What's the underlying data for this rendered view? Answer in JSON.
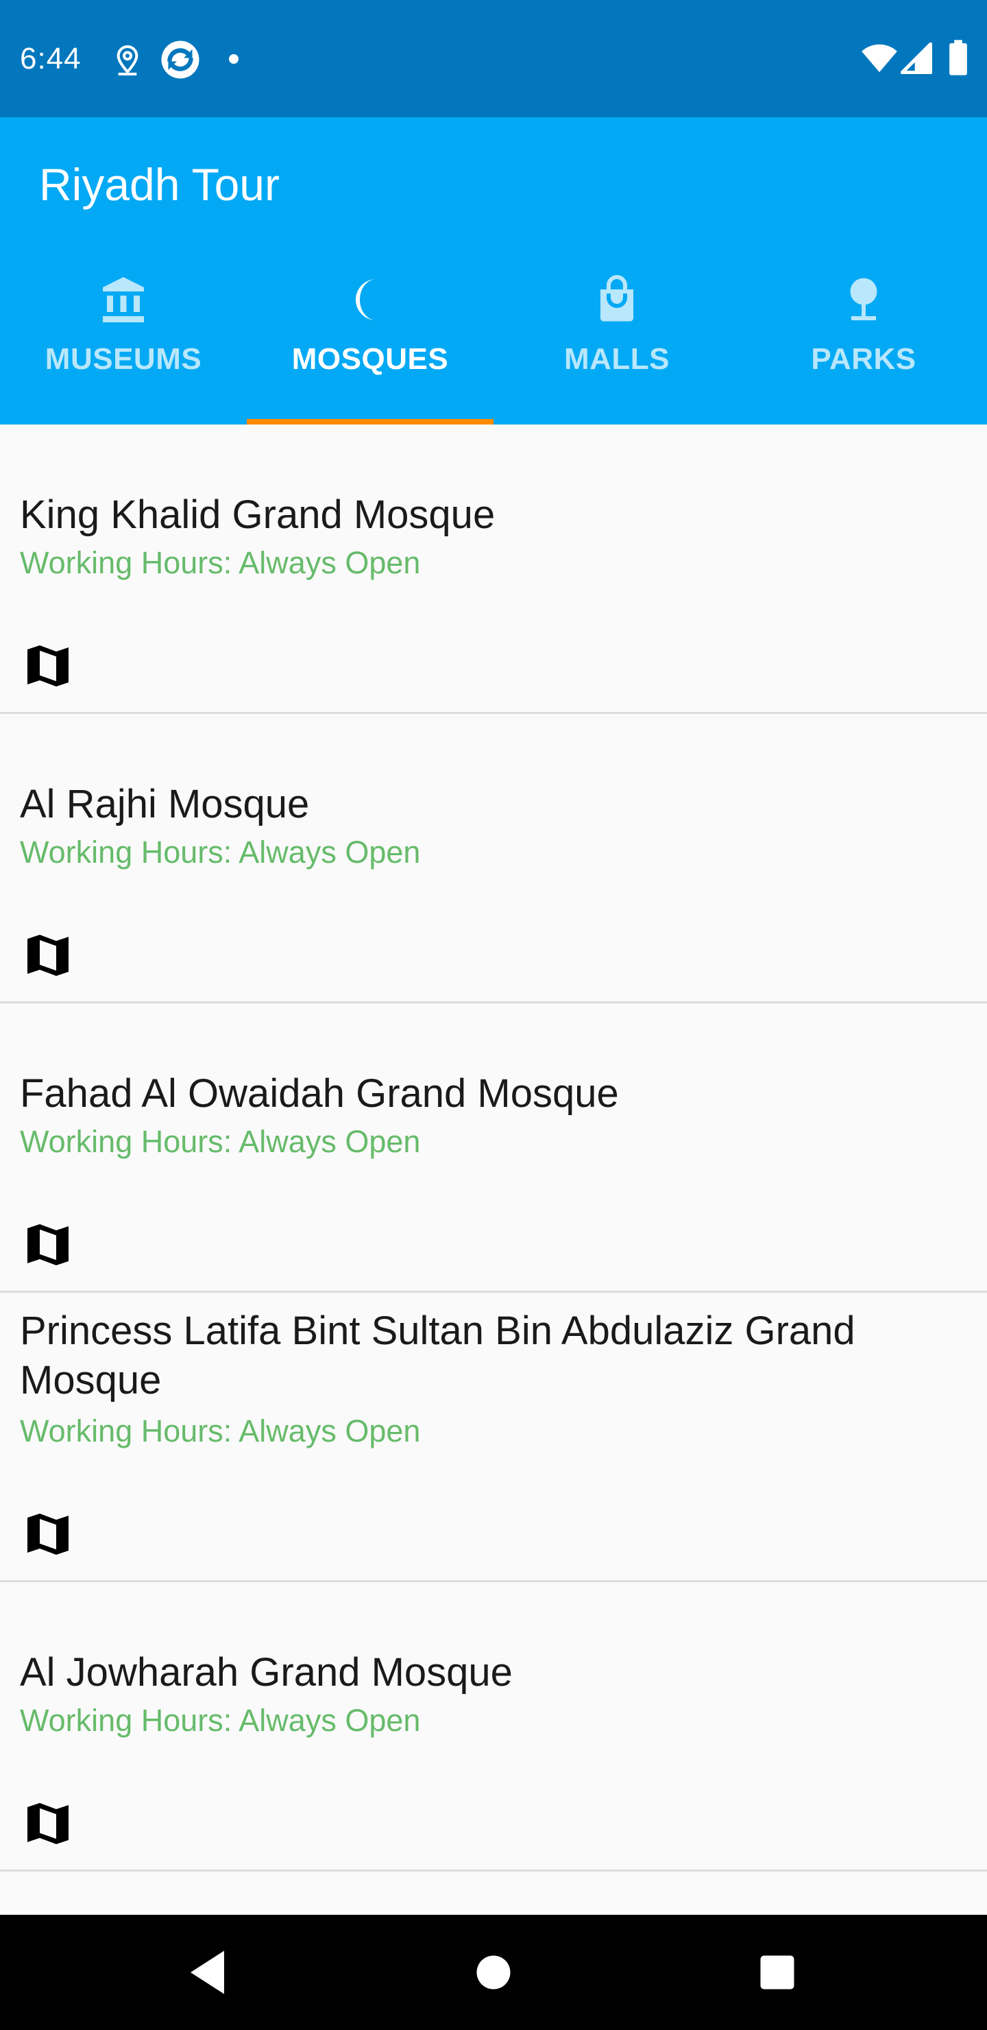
{
  "status_bar": {
    "time": "6:44",
    "icons_left": [
      "location-pin-icon",
      "sync-app-icon",
      "notification-dot-icon"
    ],
    "icons_right": [
      "wifi-icon",
      "cell-signal-icon",
      "battery-icon"
    ],
    "background": "#0277bd"
  },
  "app_bar": {
    "title": "Riyadh Tour",
    "background": "#03a9f4"
  },
  "tabs": [
    {
      "label": "MUSEUMS",
      "icon": "museum-icon",
      "selected": false
    },
    {
      "label": "MOSQUES",
      "icon": "crescent-moon-icon",
      "selected": true
    },
    {
      "label": "MALLS",
      "icon": "shopping-bag-icon",
      "selected": false
    },
    {
      "label": "PARKS",
      "icon": "tree-icon",
      "selected": false
    }
  ],
  "tab_indicator_color": "#ff8a00",
  "places": [
    {
      "name": "King Khalid Grand Mosque",
      "hours": "Working Hours: Always Open",
      "icon": "map-icon"
    },
    {
      "name": "Al Rajhi Mosque",
      "hours": "Working Hours: Always Open",
      "icon": "map-icon"
    },
    {
      "name": "Fahad Al Owaidah Grand Mosque",
      "hours": "Working Hours: Always Open",
      "icon": "map-icon"
    },
    {
      "name": "Princess Latifa Bint Sultan Bin Abdulaziz Grand Mosque",
      "hours": "Working Hours: Always Open",
      "icon": "map-icon"
    },
    {
      "name": "Al Jowharah Grand Mosque",
      "hours": "Working Hours: Always Open",
      "icon": "map-icon"
    }
  ],
  "hours_color": "#66bb6a",
  "nav_bar": {
    "buttons": [
      "back-icon",
      "home-icon",
      "recents-icon"
    ]
  }
}
